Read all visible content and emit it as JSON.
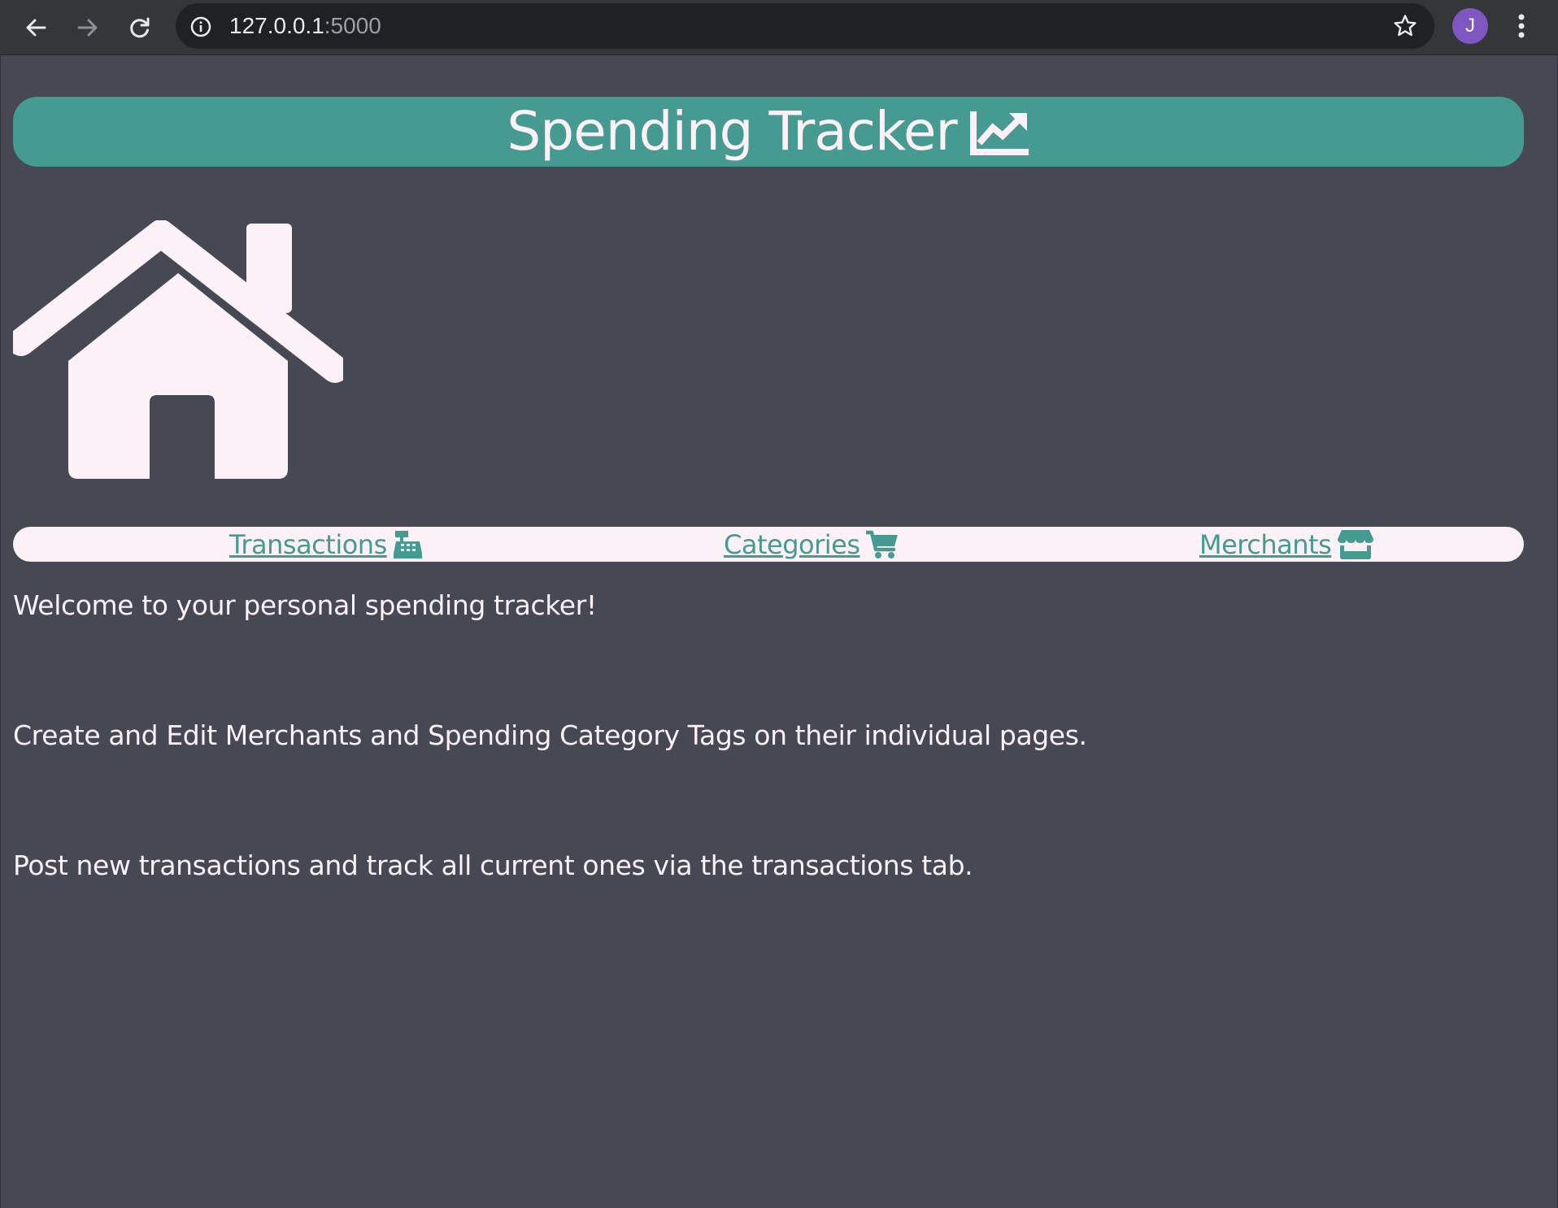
{
  "browser": {
    "url_host": "127.0.0.1",
    "url_port": ":5000",
    "profile_initial": "J",
    "icons": {
      "back": "arrow-left-icon",
      "forward": "arrow-right-icon",
      "reload": "reload-icon",
      "site_info": "info-icon",
      "bookmark": "star-icon",
      "menu": "kebab-menu-icon"
    }
  },
  "header": {
    "title": "Spending Tracker",
    "icon": "chart-line-icon"
  },
  "hero": {
    "icon": "home-icon"
  },
  "nav": {
    "items": [
      {
        "label": "Transactions",
        "icon": "cash-register-icon"
      },
      {
        "label": "Categories",
        "icon": "cart-icon"
      },
      {
        "label": "Merchants",
        "icon": "store-icon"
      }
    ]
  },
  "content": {
    "paragraphs": [
      "Welcome to your personal spending tracker!",
      "Create and Edit Merchants and Spending Category Tags on their individual pages.",
      "Post new transactions and track all current ones via the transactions tab."
    ]
  },
  "colors": {
    "page_background": "#464953",
    "accent_teal": "#459a92",
    "light_pink": "#fbf1f7",
    "browser_toolbar": "#35363a",
    "omnibox": "#202124",
    "avatar": "#7e57c2"
  }
}
